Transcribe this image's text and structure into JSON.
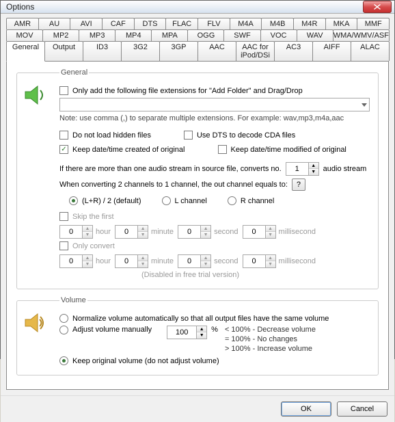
{
  "window": {
    "title": "Options"
  },
  "tabs_row1": [
    "AMR",
    "AU",
    "AVI",
    "CAF",
    "DTS",
    "FLAC",
    "FLV",
    "M4A",
    "M4B",
    "M4R",
    "MKA",
    "MMF"
  ],
  "tabs_row2": [
    "MOV",
    "MP2",
    "MP3",
    "MP4",
    "MPA",
    "OGG",
    "SWF",
    "VOC",
    "WAV",
    "WMA/WMV/ASF"
  ],
  "tabs_row3": [
    "General",
    "Output",
    "ID3",
    "3G2",
    "3GP",
    "AAC",
    "AAC for iPod/DSi",
    "AC3",
    "AIFF",
    "ALAC"
  ],
  "active_tab": "General",
  "general": {
    "legend": "General",
    "only_add_label": "Only add the following file extensions for \"Add Folder\" and Drag/Drop",
    "only_add_checked": false,
    "ext_combo_value": "",
    "note": "Note: use comma (,) to separate multiple extensions. For example: wav,mp3,m4a,aac",
    "hidden_files_label": "Do not load hidden files",
    "hidden_files_checked": false,
    "use_dts_label": "Use DTS to decode CDA files",
    "use_dts_checked": false,
    "keep_created_label": "Keep date/time created of original",
    "keep_created_checked": true,
    "keep_modified_label": "Keep date/time modified of original",
    "keep_modified_checked": false,
    "multi_stream_prefix": "If there are more than one audio stream in source file, converts no.",
    "multi_stream_value": "1",
    "multi_stream_suffix": "audio stream",
    "downmix_prefix": "When converting 2 channels to 1 channel, the out channel equals to:",
    "channel_opts": [
      "(L+R) / 2 (default)",
      "L channel",
      "R channel"
    ],
    "channel_selected": 0,
    "skip_label": "Skip the first",
    "only_convert_label": "Only convert",
    "t_units": [
      "hour",
      "minute",
      "second",
      "millisecond"
    ],
    "t_zero": "0",
    "disabled_note": "(Disabled in free trial version)"
  },
  "volume": {
    "legend": "Volume",
    "normalize_label": "Normalize volume automatically so that all output files have the same volume",
    "adjust_label": "Adjust volume manually",
    "adjust_value": "100",
    "percent": "%",
    "hint1": "< 100% - Decrease volume",
    "hint2": "= 100% - No changes",
    "hint3": "> 100% - Increase volume",
    "keep_label": "Keep original volume (do not adjust volume)",
    "selected": 2
  },
  "buttons": {
    "ok": "OK",
    "cancel": "Cancel"
  },
  "q": "?"
}
